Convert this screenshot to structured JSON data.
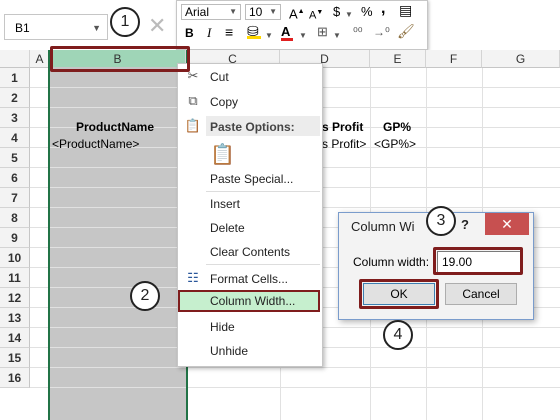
{
  "namebox": {
    "value": "B1"
  },
  "toolbar": {
    "font": "Arial",
    "size": "10",
    "grow": "A",
    "shrink": "A",
    "currency": "$",
    "percent": "%",
    "comma": ",",
    "bold": "B",
    "italic": "I",
    "font_color": "A"
  },
  "columns": [
    "A",
    "B",
    "C",
    "D",
    "E",
    "F",
    "G"
  ],
  "rows": [
    "1",
    "2",
    "3",
    "4",
    "5",
    "6",
    "7",
    "8",
    "9",
    "10",
    "11",
    "12",
    "13",
    "14",
    "15",
    "16"
  ],
  "cells": {
    "b4": "ProductName",
    "b5": "<ProductName>",
    "d4": "s Profit",
    "d5": "s Profit>",
    "e4": "GP%",
    "e5": "<GP%>"
  },
  "context_menu": {
    "cut": "Cut",
    "copy": "Copy",
    "paste_options": "Paste Options:",
    "paste_special": "Paste Special...",
    "insert": "Insert",
    "delete": "Delete",
    "clear": "Clear Contents",
    "format_cells": "Format Cells...",
    "column_width": "Column Width...",
    "hide": "Hide",
    "unhide": "Unhide"
  },
  "dialog": {
    "title": "Column Wi",
    "help": "?",
    "close": "✕",
    "label": "Column width:",
    "value": "19.00",
    "ok": "OK",
    "cancel": "Cancel"
  },
  "callouts": [
    "1",
    "2",
    "3",
    "4"
  ],
  "colors": {
    "accent": "#217346",
    "highlight": "#7f1d1d",
    "close": "#c75050"
  }
}
